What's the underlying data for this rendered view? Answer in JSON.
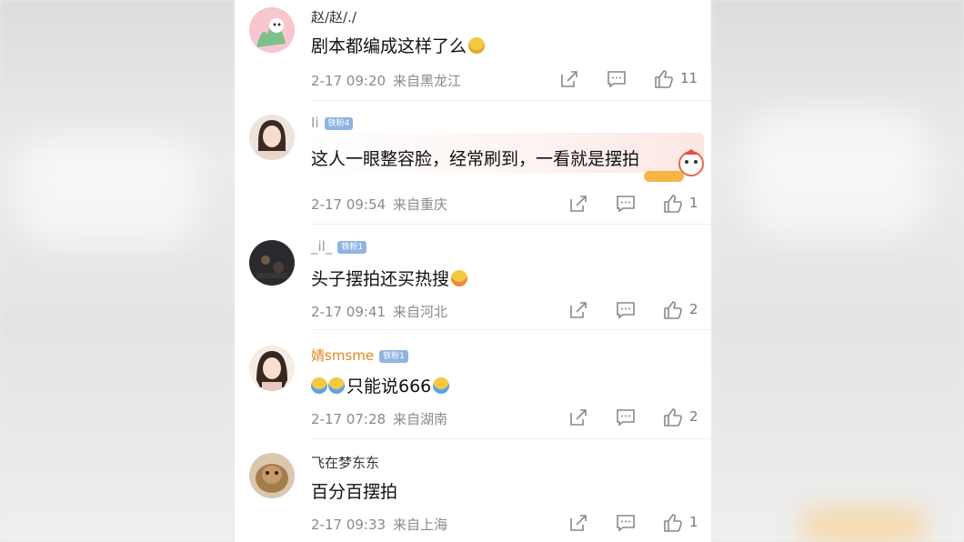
{
  "comments": [
    {
      "username": "赵/赵/./",
      "text": "剧本都编成这样了么",
      "time": "2-17 09:20",
      "location": "来自黑龙江",
      "likes": "11",
      "badge": ""
    },
    {
      "username": "Ii",
      "badge": "铁粉4",
      "text": "这人一眼整容脸，经常刷到，一看就是摆拍",
      "time": "2-17 09:54",
      "location": "来自重庆",
      "likes": "1"
    },
    {
      "username": "_il_",
      "badge": "铁粉1",
      "text": "头子摆拍还买热搜",
      "time": "2-17 09:41",
      "location": "来自河北",
      "likes": "2"
    },
    {
      "username": "婧smsme",
      "badge": "铁粉1",
      "text": "只能说666",
      "time": "2-17 07:28",
      "location": "来自湖南",
      "likes": "2"
    },
    {
      "username": "飞在梦东东",
      "badge": "",
      "text": "百分百摆拍",
      "time": "2-17 09:33",
      "location": "来自上海",
      "likes": "1"
    }
  ],
  "icons": {
    "share": "share-icon",
    "comment": "comment-icon",
    "like": "like-icon"
  },
  "colors": {
    "username": "#333333",
    "username_vip": "#e2871d",
    "badge": "#8fb4e3",
    "meta": "#8a8a8a"
  }
}
